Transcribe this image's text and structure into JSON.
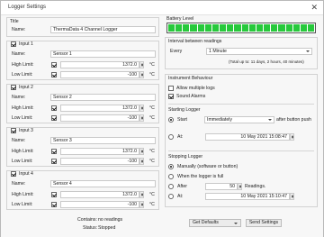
{
  "window": {
    "title": "Logger Settings"
  },
  "title_section": {
    "heading": "Title",
    "name_label": "Name:",
    "name_value": "ThermaData 4 Channel Logger"
  },
  "inputs": [
    {
      "label": "Input 1",
      "name_label": "Name:",
      "name_value": "Sensor 1",
      "high_label": "High Limit:",
      "high_value": "1372.0",
      "low_label": "Low Limit:",
      "low_value": "-100",
      "unit": "°C"
    },
    {
      "label": "Input 2",
      "name_label": "Name:",
      "name_value": "Sensor 2",
      "high_label": "High Limit:",
      "high_value": "1372.0",
      "low_label": "Low Limit:",
      "low_value": "-100",
      "unit": "°C"
    },
    {
      "label": "Input 3",
      "name_label": "Name:",
      "name_value": "Sensor 3",
      "high_label": "High Limit:",
      "high_value": "1372.0",
      "low_label": "Low Limit:",
      "low_value": "-100",
      "unit": "°C"
    },
    {
      "label": "Input 4",
      "name_label": "Name:",
      "name_value": "Sensor 4",
      "high_label": "High Limit:",
      "high_value": "1372.0",
      "low_label": "Low Limit:",
      "low_value": "-100",
      "unit": "°C"
    }
  ],
  "footer": {
    "contains_label": "Contains:",
    "contains_value": "no readings",
    "status_label": "Status:",
    "status_value": "Stopped"
  },
  "battery": {
    "label": "Battery Level",
    "segments": 20,
    "level_fraction": 1.0,
    "color": "#27c93b"
  },
  "interval": {
    "heading": "Interval between readings",
    "every_label": "Every",
    "every_value": "1 Minute",
    "note": "(Total up to: 11 days, 2 hours, 40 minutes)"
  },
  "behaviour": {
    "heading": "Instrument Behaviour",
    "allow_multiple": "Allow multiple logs",
    "sound_alarms": "Sound Alarms"
  },
  "starting": {
    "heading": "Starting Logger",
    "start_label": "Start",
    "start_value": "Immediately",
    "after_label": "after button push",
    "at_label": "At:",
    "at_value": "10 May 2021 15:08:47"
  },
  "stopping": {
    "heading": "Stopping Logger",
    "manually_label": "Manually (software or button)",
    "full_label": "When the logger is full",
    "after_label": "After",
    "after_value": "50",
    "readings_label": "Readings.",
    "at_label": "At:",
    "at_value": "10 May 2021 15:10:47"
  },
  "buttons": {
    "defaults": "Get Defaults",
    "send": "Send Settings"
  }
}
